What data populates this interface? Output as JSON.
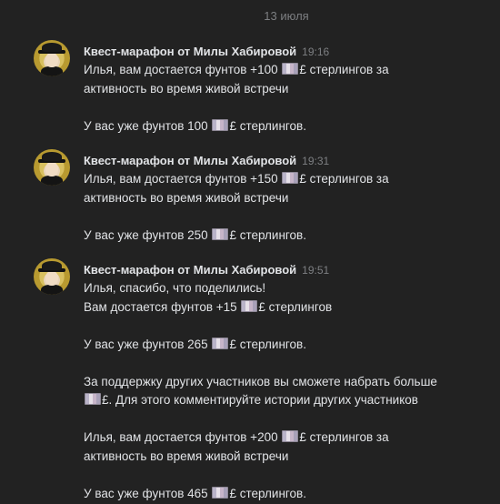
{
  "date_separator": "13 июля",
  "messages": [
    {
      "author": "Квест-марафон от Милы Хабировой",
      "time": "19:16",
      "lines": [
        {
          "pre": "Илья, вам достается фунтов +100 ",
          "coin": true,
          "post": "£ стерлингов за"
        },
        {
          "pre": "активность во время живой встречи",
          "coin": false,
          "post": ""
        },
        {
          "gap": true
        },
        {
          "pre": "У вас уже фунтов 100 ",
          "coin": true,
          "post": "£ стерлингов."
        }
      ]
    },
    {
      "author": "Квест-марафон от Милы Хабировой",
      "time": "19:31",
      "lines": [
        {
          "pre": "Илья, вам достается фунтов +150 ",
          "coin": true,
          "post": "£ стерлингов за"
        },
        {
          "pre": "активность во время живой встречи",
          "coin": false,
          "post": ""
        },
        {
          "gap": true
        },
        {
          "pre": "У вас уже фунтов 250 ",
          "coin": true,
          "post": "£ стерлингов."
        }
      ]
    },
    {
      "author": "Квест-марафон от Милы Хабировой",
      "time": "19:51",
      "lines": [
        {
          "pre": "Илья, спасибо, что поделились!",
          "coin": false,
          "post": ""
        },
        {
          "pre": "Вам достается фунтов +15 ",
          "coin": true,
          "post": "£ стерлингов"
        },
        {
          "gap": true
        },
        {
          "pre": "У вас уже фунтов 265 ",
          "coin": true,
          "post": "£ стерлингов."
        },
        {
          "gap": true
        },
        {
          "pre": "За поддержку других участников вы сможете набрать больше",
          "coin": false,
          "post": ""
        },
        {
          "pre": "",
          "coin": true,
          "post": "£. Для этого комментируйте истории других участников"
        },
        {
          "gap": true
        },
        {
          "pre": "Илья, вам достается фунтов +200 ",
          "coin": true,
          "post": "£ стерлингов за"
        },
        {
          "pre": "активность во время живой встречи",
          "coin": false,
          "post": ""
        },
        {
          "gap": true
        },
        {
          "pre": "У вас уже фунтов 465 ",
          "coin": true,
          "post": "£ стерлингов."
        }
      ]
    }
  ]
}
